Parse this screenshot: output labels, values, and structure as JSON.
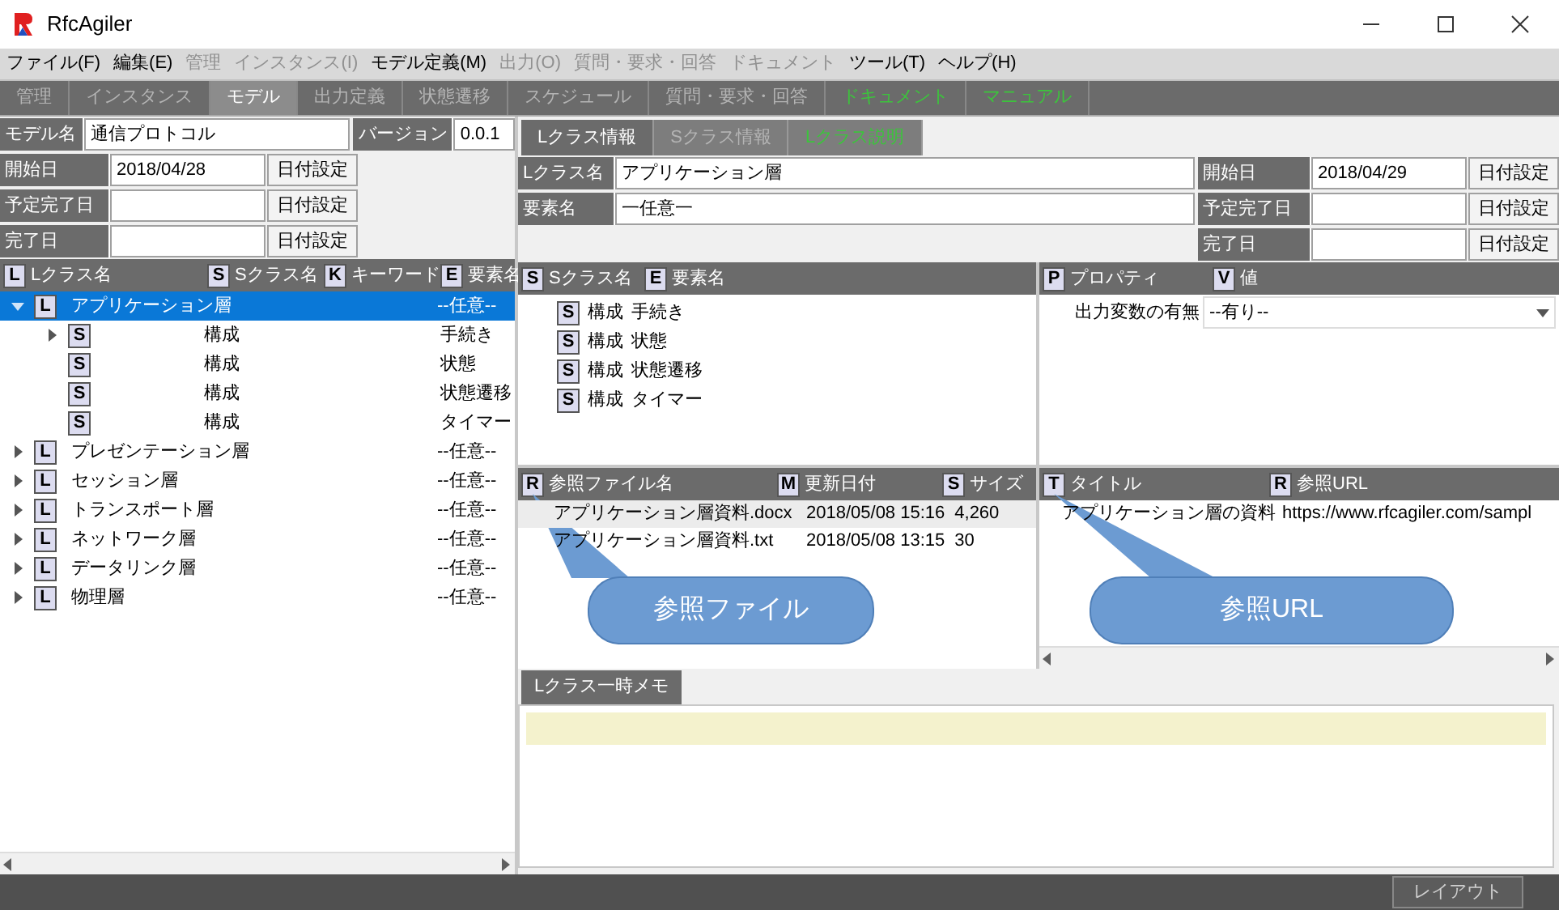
{
  "window": {
    "title": "RfcAgiler"
  },
  "menu": [
    {
      "label": "ファイル(F)",
      "disabled": false
    },
    {
      "label": "編集(E)",
      "disabled": false
    },
    {
      "label": "管理",
      "disabled": true
    },
    {
      "label": "インスタンス(I)",
      "disabled": true
    },
    {
      "label": "モデル定義(M)",
      "disabled": false
    },
    {
      "label": "出力(O)",
      "disabled": true
    },
    {
      "label": "質問・要求・回答",
      "disabled": true
    },
    {
      "label": "ドキュメント",
      "disabled": true
    },
    {
      "label": "ツール(T)",
      "disabled": false
    },
    {
      "label": "ヘルプ(H)",
      "disabled": false
    }
  ],
  "main_tabs": [
    {
      "label": "管理",
      "selected": false,
      "kind": "page"
    },
    {
      "label": "インスタンス",
      "selected": false,
      "kind": "page"
    },
    {
      "label": "モデル",
      "selected": true,
      "kind": "page"
    },
    {
      "label": "出力定義",
      "selected": false,
      "kind": "page"
    },
    {
      "label": "状態遷移",
      "selected": false,
      "kind": "page"
    },
    {
      "label": "スケジュール",
      "selected": false,
      "kind": "page"
    },
    {
      "label": "質問・要求・回答",
      "selected": false,
      "kind": "page"
    },
    {
      "label": "ドキュメント",
      "selected": false,
      "kind": "link"
    },
    {
      "label": "マニュアル",
      "selected": false,
      "kind": "link"
    }
  ],
  "model": {
    "name_label": "モデル名",
    "name": "通信プロトコル",
    "version_label": "バージョン",
    "version": "0.0.1",
    "dates": [
      {
        "label": "開始日",
        "value": "2018/04/28",
        "button": "日付設定"
      },
      {
        "label": "予定完了日",
        "button": "日付設定"
      },
      {
        "label": "完了日",
        "button": "日付設定"
      }
    ]
  },
  "tree": {
    "columns": [
      {
        "badge": "L",
        "label": "Lクラス名"
      },
      {
        "badge": "S",
        "label": "Sクラス名"
      },
      {
        "badge": "K",
        "label": "キーワード"
      },
      {
        "badge": "E",
        "label": "要素名"
      }
    ],
    "items": [
      {
        "badge": "L",
        "name": "アプリケーション層",
        "element": "--任意--",
        "expanded": true,
        "selected": true,
        "children": [
          {
            "badge": "S",
            "sclass": "構成",
            "element": "手続き",
            "kind": "branch",
            "expanded": false
          },
          {
            "badge": "S",
            "sclass": "構成",
            "element": "状態",
            "kind": "leaf"
          },
          {
            "badge": "S",
            "sclass": "構成",
            "element": "状態遷移",
            "kind": "leaf"
          },
          {
            "badge": "S",
            "sclass": "構成",
            "element": "タイマー",
            "kind": "leaf"
          }
        ]
      },
      {
        "badge": "L",
        "name": "プレゼンテーション層",
        "element": "--任意--",
        "expanded": false,
        "selected": false
      },
      {
        "badge": "L",
        "name": "セッション層",
        "element": "--任意--",
        "expanded": false,
        "selected": false
      },
      {
        "badge": "L",
        "name": "トランスポート層",
        "element": "--任意--",
        "expanded": false,
        "selected": false
      },
      {
        "badge": "L",
        "name": "ネットワーク層",
        "element": "--任意--",
        "expanded": false,
        "selected": false
      },
      {
        "badge": "L",
        "name": "データリンク層",
        "element": "--任意--",
        "expanded": false,
        "selected": false
      },
      {
        "badge": "L",
        "name": "物理層",
        "element": "--任意--",
        "expanded": false,
        "selected": false
      }
    ]
  },
  "right_tabs": [
    {
      "label": "Lクラス情報",
      "selected": true,
      "kind": "page"
    },
    {
      "label": "Sクラス情報",
      "selected": false,
      "kind": "page"
    },
    {
      "label": "Lクラス説明",
      "selected": false,
      "kind": "link"
    }
  ],
  "lclass": {
    "name_label": "Lクラス名",
    "name": "アプリケーション層",
    "element_label": "要素名",
    "element": "一任意一",
    "dates": [
      {
        "label": "開始日",
        "value": "2018/04/29",
        "button": "日付設定"
      },
      {
        "label": "予定完了日",
        "button": "日付設定"
      },
      {
        "label": "完了日",
        "button": "日付設定"
      }
    ]
  },
  "sclass_list": {
    "columns": [
      {
        "badge": "S",
        "label": "Sクラス名"
      },
      {
        "badge": "E",
        "label": "要素名"
      }
    ],
    "rows": [
      {
        "badge": "S",
        "sclass": "構成",
        "element": "手続き"
      },
      {
        "badge": "S",
        "sclass": "構成",
        "element": "状態"
      },
      {
        "badge": "S",
        "sclass": "構成",
        "element": "状態遷移"
      },
      {
        "badge": "S",
        "sclass": "構成",
        "element": "タイマー"
      }
    ]
  },
  "properties": {
    "columns": [
      {
        "badge": "P",
        "label": "プロパティ"
      },
      {
        "badge": "V",
        "label": "値"
      }
    ],
    "rows": [
      {
        "name": "出力変数の有無",
        "value": "--有り--"
      }
    ]
  },
  "files": {
    "columns": [
      {
        "badge": "R",
        "label": "参照ファイル名"
      },
      {
        "badge": "M",
        "label": "更新日付"
      },
      {
        "badge": "S",
        "label": "サイズ"
      }
    ],
    "rows": [
      {
        "name": "アプリケーション層資料.docx",
        "date": "2018/05/08 15:16",
        "size": "4,260",
        "selected": true
      },
      {
        "name": "アプリケーション層資料.txt",
        "date": "2018/05/08 13:15",
        "size": "30",
        "selected": false
      }
    ]
  },
  "urls": {
    "columns": [
      {
        "badge": "T",
        "label": "タイトル"
      },
      {
        "badge": "R",
        "label": "参照URL"
      }
    ],
    "rows": [
      {
        "title": "アプリケーション層の資料",
        "url": "https://www.rfcagiler.com/sampl"
      }
    ]
  },
  "memo": {
    "tab": "Lクラス一時メモ"
  },
  "callouts": [
    "参照ファイル",
    "参照URL"
  ],
  "status_bar": {
    "button": "レイアウト"
  }
}
